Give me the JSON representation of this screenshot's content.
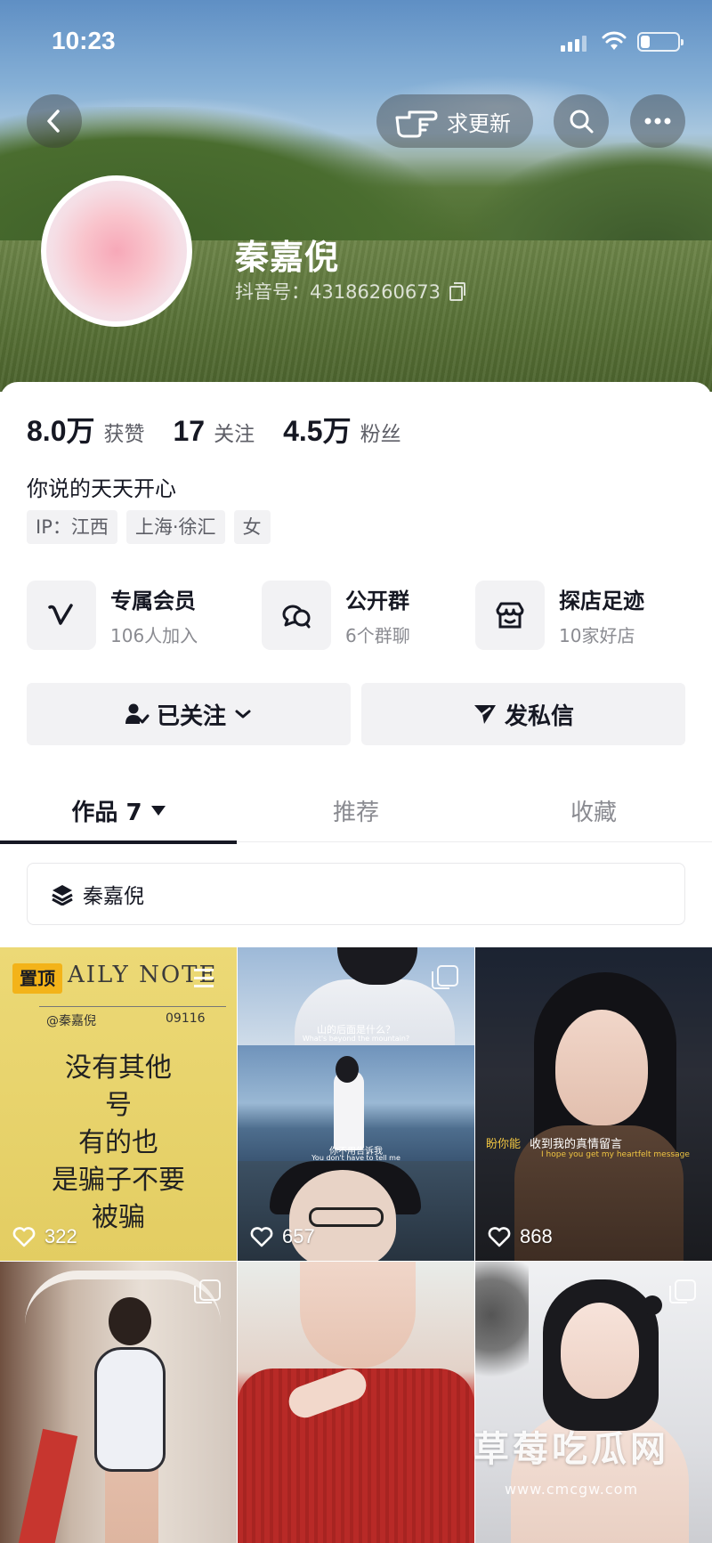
{
  "status_bar": {
    "time": "10:23",
    "battery_level": 0.25
  },
  "header": {
    "request_update_label": "求更新",
    "profile_name": "秦嘉倪",
    "douyin_id": "抖音号：43186260673"
  },
  "stats": [
    {
      "value": "8.0万",
      "label": "获赞"
    },
    {
      "value": "17",
      "label": "关注"
    },
    {
      "value": "4.5万",
      "label": "粉丝"
    }
  ],
  "bio": "你说的天天开心",
  "tags": [
    "IP：江西",
    "上海·徐汇",
    "女"
  ],
  "features": [
    {
      "title": "专属会员",
      "subtitle": "106人加入",
      "icon": "vip-v-icon"
    },
    {
      "title": "公开群",
      "subtitle": "6个群聊",
      "icon": "group-chat-icon"
    },
    {
      "title": "探店足迹",
      "subtitle": "10家好店",
      "icon": "shop-icon"
    }
  ],
  "actions": {
    "follow_label": "已关注",
    "message_label": "发私信"
  },
  "tabs": [
    {
      "label": "作品 7",
      "active": true
    },
    {
      "label": "推荐",
      "active": false
    },
    {
      "label": "收藏",
      "active": false
    }
  ],
  "collection": {
    "label": "秦嘉倪"
  },
  "videos": [
    {
      "likes": "322",
      "pinned_label": "置顶",
      "header": "AILY NOTE",
      "signature": "@秦嘉倪",
      "date": "09116",
      "lines": [
        "没有其他",
        "号",
        "有的也",
        "是骗子不要",
        "被骗"
      ]
    },
    {
      "likes": "657",
      "captions": [
        "山的后面是什么？",
        "What's beyond the mountain?",
        "你不用告诉我",
        "You don't have to tell me"
      ]
    },
    {
      "likes": "868",
      "caption_highlight": "盼你能",
      "caption": "收到我的真情留言",
      "caption_sub": "I hope you get my heartfelt message"
    },
    {
      "likes": ""
    },
    {
      "likes": ""
    },
    {
      "likes": ""
    }
  ],
  "watermark": {
    "title": "草莓吃瓜网",
    "url": "www.cmcgw.com"
  },
  "colors": {
    "text_primary": "#161823",
    "text_secondary": "#8a8b91",
    "chip_bg": "#f2f2f4",
    "pin_badge": "#f3b319"
  }
}
